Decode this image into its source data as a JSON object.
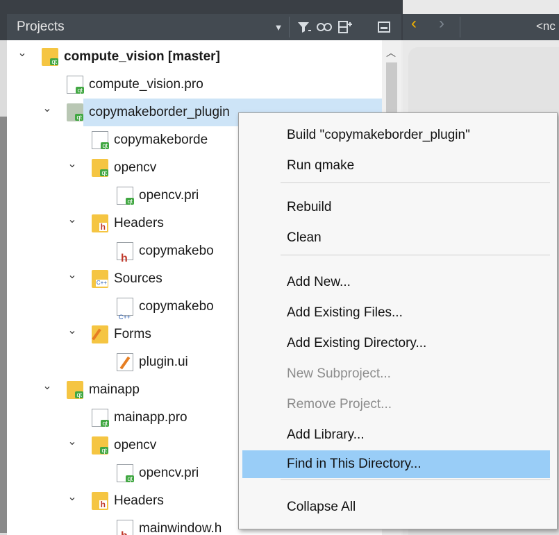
{
  "panel": {
    "title": "Projects",
    "tools": [
      "dropdown-arrow-icon",
      "filter-icon",
      "link-icon",
      "split-icon",
      "close-panel-icon"
    ]
  },
  "editor": {
    "breadcrumb": "<nc"
  },
  "tree": [
    {
      "label": "compute_vision [master]",
      "bold": true,
      "icon": "qt-folder-icon",
      "expanded": true
    },
    {
      "label": "compute_vision.pro",
      "icon": "qt-file-icon"
    },
    {
      "label": "copymakeborder_plugin",
      "icon": "qt-folder-icon",
      "expanded": true,
      "selected": true
    },
    {
      "label": "copymakeborde",
      "icon": "qt-file-icon"
    },
    {
      "label": "opencv",
      "icon": "qt-folder-icon",
      "expanded": true
    },
    {
      "label": "opencv.pri",
      "icon": "qt-file-icon"
    },
    {
      "label": "Headers",
      "icon": "header-folder-icon",
      "expanded": true
    },
    {
      "label": "copymakebo",
      "icon": "header-file-icon"
    },
    {
      "label": "Sources",
      "icon": "source-folder-icon",
      "expanded": true
    },
    {
      "label": "copymakebo",
      "icon": "cpp-file-icon"
    },
    {
      "label": "Forms",
      "icon": "forms-folder-icon",
      "expanded": true
    },
    {
      "label": "plugin.ui",
      "icon": "ui-file-icon"
    },
    {
      "label": "mainapp",
      "icon": "qt-folder-icon",
      "expanded": true
    },
    {
      "label": "mainapp.pro",
      "icon": "qt-file-icon"
    },
    {
      "label": "opencv",
      "icon": "qt-folder-icon",
      "expanded": true
    },
    {
      "label": "opencv.pri",
      "icon": "qt-file-icon"
    },
    {
      "label": "Headers",
      "icon": "header-folder-icon",
      "expanded": true
    },
    {
      "label": "mainwindow.h",
      "icon": "header-file-icon"
    }
  ],
  "context_menu": {
    "items": [
      {
        "label": "Build \"copymakeborder_plugin\"",
        "enabled": true
      },
      {
        "label": "Run qmake",
        "enabled": true
      },
      {
        "separator": true
      },
      {
        "label": "Rebuild",
        "enabled": true
      },
      {
        "label": "Clean",
        "enabled": true
      },
      {
        "separator": true
      },
      {
        "label": "Add New...",
        "enabled": true
      },
      {
        "label": "Add Existing Files...",
        "enabled": true
      },
      {
        "label": "Add Existing Directory...",
        "enabled": true
      },
      {
        "label": "New Subproject...",
        "enabled": false
      },
      {
        "label": "Remove Project...",
        "enabled": false
      },
      {
        "label": "Add Library...",
        "enabled": true
      },
      {
        "label": "Find in This Directory...",
        "enabled": true,
        "highlighted": true
      },
      {
        "separator": true
      },
      {
        "label": "Collapse All",
        "enabled": true
      }
    ]
  }
}
